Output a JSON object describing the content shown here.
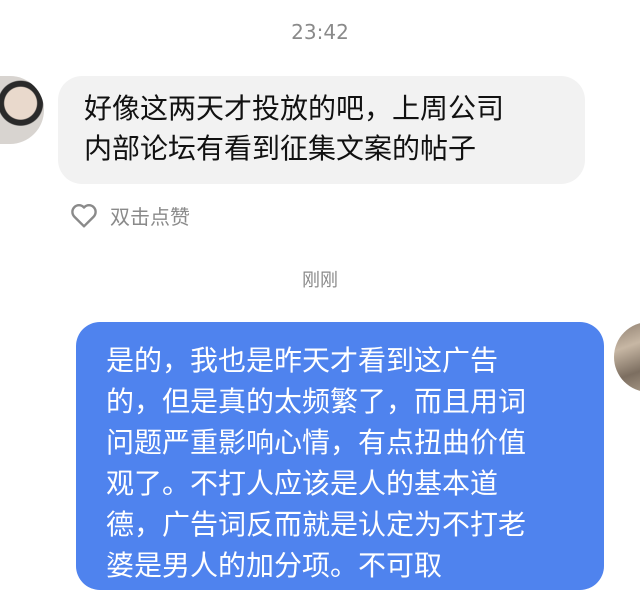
{
  "chat": {
    "timestamp_top": "23:42",
    "timestamp_mid": "刚刚",
    "incoming": {
      "lines": [
        "好像这两天才投放的吧，上周公司",
        "内部论坛有看到征集文案的帖子"
      ]
    },
    "like": {
      "label": "双击点赞",
      "icon": "heart-icon"
    },
    "outgoing": {
      "lines": [
        "是的，我也是昨天才看到这广告",
        "的，但是真的太频繁了，而且用词",
        "问题严重影响心情，有点扭曲价值",
        "观了。不打人应该是人的基本道",
        "德，广告词反而就是认定为不打老",
        "婆是男人的加分项。不可取"
      ]
    }
  },
  "colors": {
    "incoming_bubble": "#f2f2f2",
    "outgoing_bubble": "#4f83ee",
    "timestamp": "#8a8a8a"
  }
}
